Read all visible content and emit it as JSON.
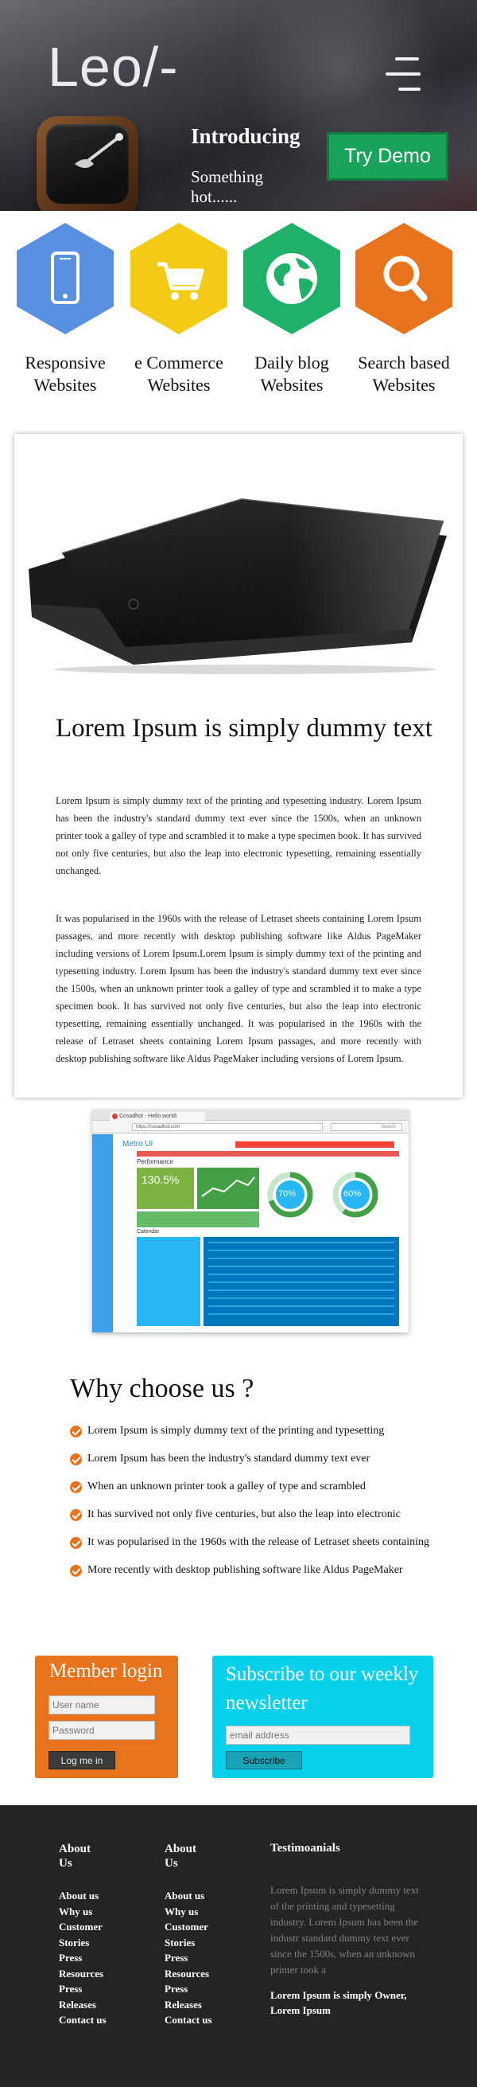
{
  "header": {
    "logo_text": "Leo/-",
    "intro_title": "Introducing",
    "intro_subtitle": "Something hot......",
    "try_demo_label": "Try Demo"
  },
  "features": [
    {
      "label": "Responsive Websites",
      "icon": "smartphone-icon",
      "color": "#5b8fe0"
    },
    {
      "label": "e Commerce Websites",
      "icon": "shopping-cart-icon",
      "color": "#f3ca16"
    },
    {
      "label": "Daily blog Websites",
      "icon": "globe-icon",
      "color": "#1fb16a"
    },
    {
      "label": "Search based Websites",
      "icon": "search-icon",
      "color": "#e7731c"
    }
  ],
  "article": {
    "title": "Lorem Ipsum is simply dummy text",
    "paragraph_1": "Lorem Ipsum is simply dummy text of the printing and typesetting industry. Lorem Ipsum has been the industry's standard dummy text ever since the 1500s, when an unknown printer took a galley of type and scrambled it to make a type specimen book. It has survived not only five centuries, but also the leap into electronic typesetting, remaining essentially unchanged.",
    "paragraph_2": "It was popularised in the 1960s with the release of Letraset sheets containing Lorem Ipsum passages, and more recently with desktop publishing software like Aldus PageMaker including versions of Lorem Ipsum.Lorem Ipsum is simply dummy text of the printing and typesetting industry. Lorem Ipsum has been the industry's standard dummy text ever since the 1500s, when an unknown printer took a galley of type and scrambled it to make a type specimen book. It has survived not only five centuries, but also the leap into electronic typesetting, remaining essentially unchanged. It was popularised in the 1960s with the release of Letraset sheets containing Lorem Ipsum passages, and more recently with desktop publishing software like Aldus PageMaker including versions of Lorem Ipsum."
  },
  "screenshot": {
    "browser_tab": "Cosadhot - Hello world!",
    "url": "https://cosadhot.com",
    "search_placeholder": "Search",
    "app_name": "Metro UI",
    "section_title": "Performance",
    "stat_1": "130.5%",
    "stat_2": "70%",
    "stat_3": "60%",
    "calendar_label": "Calendar"
  },
  "why": {
    "title": "Why choose us ?",
    "items": [
      "Lorem Ipsum is simply dummy text of the printing and typesetting",
      "Lorem Ipsum has been the industry's standard dummy text ever",
      "When an unknown printer took a galley of type and scrambled",
      "It has survived not only five centuries, but also the leap into electronic",
      "It was popularised in the 1960s with the release of Letraset sheets containing",
      "More recently with desktop publishing software like Aldus PageMaker"
    ]
  },
  "login": {
    "title": "Member login",
    "username_placeholder": "User name",
    "password_placeholder": "Password",
    "button_label": "Log me in"
  },
  "subscribe": {
    "title": "Subscribe to our weekly newsletter",
    "email_placeholder": "email address",
    "button_label": "Subscribe"
  },
  "footer": {
    "col1": {
      "title": "About Us",
      "links": [
        "About us",
        "Why us",
        "Customer Stories",
        "Press Resources",
        "Press Releases",
        "Contact us"
      ]
    },
    "col2": {
      "title": "About Us",
      "links": [
        "About us",
        "Why us",
        "Customer Stories",
        "Press Resources",
        "Press Releases",
        "Contact us"
      ]
    },
    "testimonials": {
      "title": "Testimoanials",
      "quote": "Lorem Ipsum is simply dummy text of the printing and typesetting industry. Lorem Ipsum has been the industr standard dummy text ever since the 1500s, when an unknown printer took a",
      "author": "Lorem Ipsum is simply Owner, Lorem Ipsum"
    }
  },
  "colors": {
    "try_demo": "#1aa45b",
    "accent_orange": "#e8731d",
    "accent_cyan": "#08d1ec",
    "footer_bg": "#222523"
  }
}
